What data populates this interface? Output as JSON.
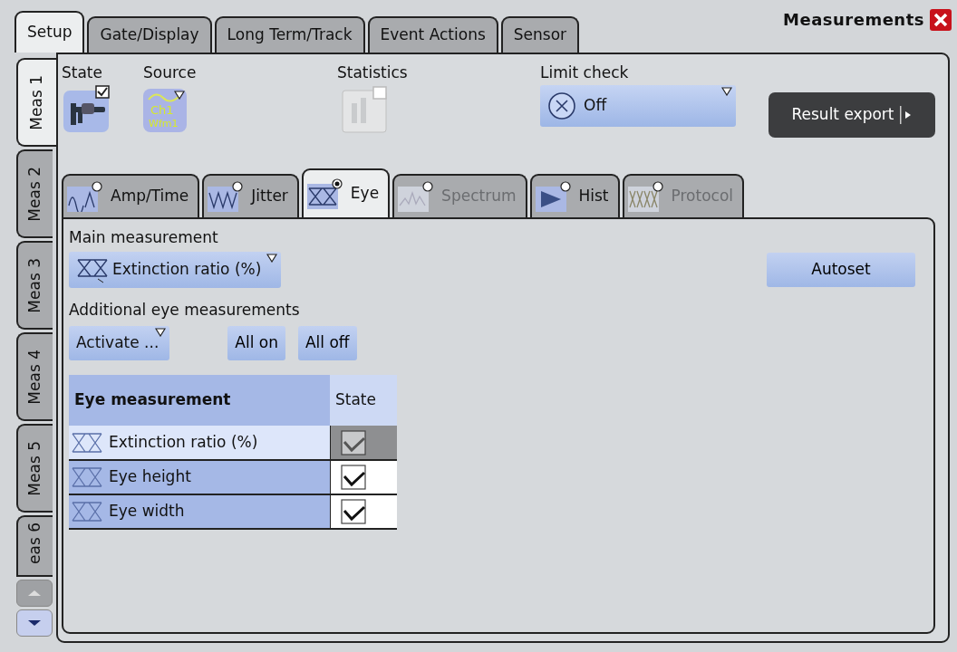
{
  "top_tabs": [
    {
      "label": "Setup",
      "selected": true
    },
    {
      "label": "Gate/Display",
      "selected": false
    },
    {
      "label": "Long Term/Track",
      "selected": false
    },
    {
      "label": "Event Actions",
      "selected": false
    },
    {
      "label": "Sensor",
      "selected": false
    }
  ],
  "window": {
    "title": "Measurements"
  },
  "side_tabs": [
    {
      "label": "Meas 1",
      "selected": true
    },
    {
      "label": "Meas 2",
      "selected": false
    },
    {
      "label": "Meas 3",
      "selected": false
    },
    {
      "label": "Meas 4",
      "selected": false
    },
    {
      "label": "Meas 5",
      "selected": false
    },
    {
      "label": "eas 6",
      "selected": false
    }
  ],
  "side_scroll": {
    "up_disabled": true
  },
  "state": {
    "label": "State",
    "checked": true
  },
  "source": {
    "label": "Source",
    "channel": "Ch1",
    "waveform": "Wfm1"
  },
  "statistics": {
    "label": "Statistics",
    "checked": false,
    "disabled": true
  },
  "limit_check": {
    "label": "Limit check",
    "value": "Off"
  },
  "result_export": {
    "label": "Result export"
  },
  "category_tabs": [
    {
      "label": "Amp/Time",
      "kind": "amptime",
      "selected": false,
      "disabled": false,
      "in_use": false
    },
    {
      "label": "Jitter",
      "kind": "jitter",
      "selected": false,
      "disabled": false,
      "in_use": false
    },
    {
      "label": "Eye",
      "kind": "eye",
      "selected": true,
      "disabled": false,
      "in_use": true
    },
    {
      "label": "Spectrum",
      "kind": "spectrum",
      "selected": false,
      "disabled": true,
      "in_use": false
    },
    {
      "label": "Hist",
      "kind": "hist",
      "selected": false,
      "disabled": false,
      "in_use": false
    },
    {
      "label": "Protocol",
      "kind": "protocol",
      "selected": false,
      "disabled": true,
      "in_use": false
    }
  ],
  "main_measurement": {
    "label": "Main measurement",
    "value": "Extinction ratio (%)"
  },
  "autoset": {
    "label": "Autoset"
  },
  "additional": {
    "label": "Additional eye measurements",
    "activate": "Activate ...",
    "all_on": "All on",
    "all_off": "All off"
  },
  "table": {
    "columns": [
      "Eye measurement",
      "State"
    ],
    "rows": [
      {
        "name": "Extinction ratio (%)",
        "checked": true,
        "disabled": true
      },
      {
        "name": "Eye height",
        "checked": true,
        "disabled": false
      },
      {
        "name": "Eye width",
        "checked": true,
        "disabled": false
      }
    ]
  }
}
